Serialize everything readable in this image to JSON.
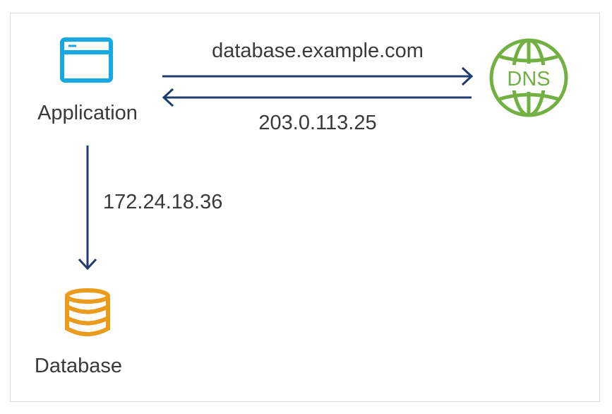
{
  "nodes": {
    "application": {
      "label": "Application",
      "icon": "browser-window-icon",
      "color": "#16a8e0"
    },
    "dns": {
      "label": "DNS",
      "icon": "globe-icon",
      "color": "#72b043"
    },
    "database": {
      "label": "Database",
      "icon": "database-icon",
      "color": "#eb9b1c"
    }
  },
  "edges": {
    "query": {
      "label": "database.example.com"
    },
    "answer": {
      "label": "203.0.113.25"
    },
    "connect": {
      "label": "172.24.18.36"
    }
  },
  "colors": {
    "arrow": "#1f3c6e",
    "text": "#3a3a3a",
    "border": "#dcdcdc"
  }
}
